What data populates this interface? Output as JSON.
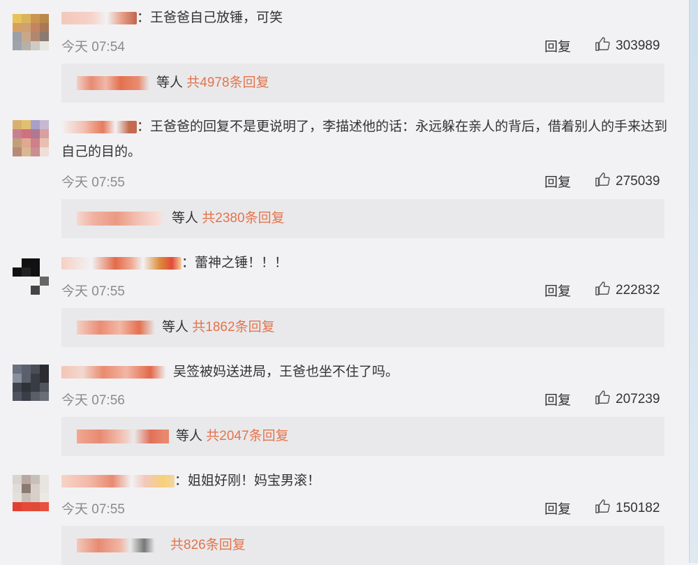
{
  "comments": [
    {
      "text": "：王爸爸自己放锤，可笑",
      "time": "今天 07:54",
      "reply_label": "回复",
      "likes": "303989",
      "sub_prefix": "等人",
      "sub_total": "共4978条回复"
    },
    {
      "text": "：王爸爸的回复不是更说明了，李描述他的话：永远躲在亲人的背后，借着别人的手来达到自己的目的。",
      "time": "今天 07:55",
      "reply_label": "回复",
      "likes": "275039",
      "sub_prefix": "等人",
      "sub_total": "共2380条回复"
    },
    {
      "text": "：蕾神之锤！！！",
      "time": "今天 07:55",
      "reply_label": "回复",
      "likes": "222832",
      "sub_prefix": "等人",
      "sub_total": "共1862条回复"
    },
    {
      "text": "吴签被妈送进局，王爸也坐不住了吗。",
      "time": "今天 07:56",
      "reply_label": "回复",
      "likes": "207239",
      "sub_prefix": "等人",
      "sub_total": "共2047条回复"
    },
    {
      "text": "：姐姐好刚！妈宝男滚！",
      "time": "今天 07:55",
      "reply_label": "回复",
      "likes": "150182",
      "sub_prefix": "",
      "sub_total": "共826条回复"
    }
  ],
  "icons": {
    "like": "thumbs-up-icon",
    "avatar": "blurred-avatar"
  },
  "colors": {
    "accent": "#e4734b",
    "background": "#f2f2f4",
    "sub_panel": "#e9e9eb",
    "muted": "#8a8a8a"
  }
}
